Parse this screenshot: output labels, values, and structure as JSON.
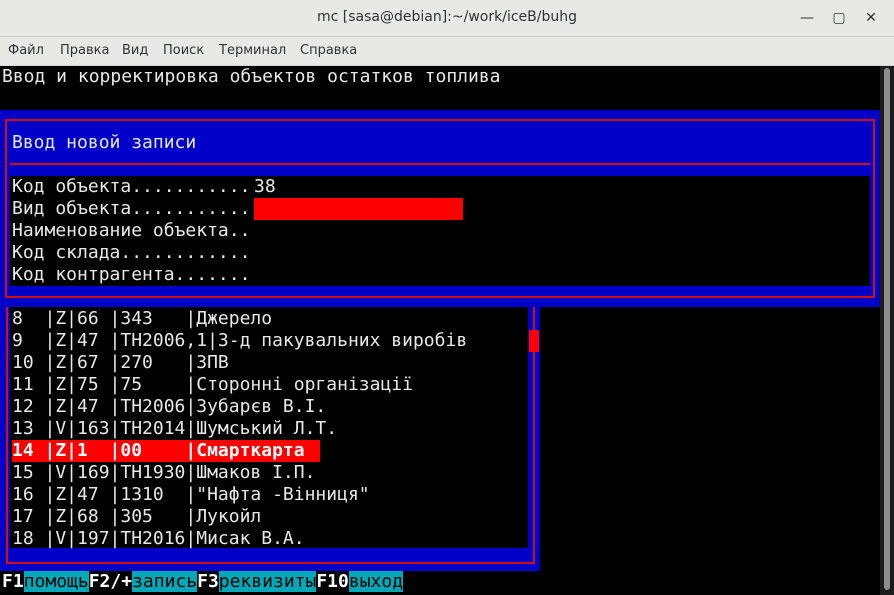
{
  "window": {
    "title": "mc [sasa@debian]:~/work/iceB/buhg"
  },
  "menu": [
    "Файл",
    "Правка",
    "Вид",
    "Поиск",
    "Терминал",
    "Справка"
  ],
  "screen_title": "Ввод и корректировка объектов остатков топлива",
  "dialog": {
    "title": "Ввод новой записи",
    "fields": [
      {
        "label": "Код объекта...........",
        "value": "38"
      },
      {
        "label": "Вид объекта...........",
        "value": ""
      },
      {
        "label": "Наименование объекта..",
        "value": ""
      },
      {
        "label": "Код склада............",
        "value": ""
      },
      {
        "label": "Код контрагента.......",
        "value": ""
      }
    ]
  },
  "list": {
    "rows": [
      "8  |Z|66 |343   |Джерело",
      "9  |Z|47 |TH2006,1|3-д пакувальних виробів",
      "10 |Z|67 |270   |ЗПВ",
      "11 |Z|75 |75    |Сторонні організації",
      "12 |Z|47 |TH2006|Зубарєв В.І.",
      "13 |V|163|TH2014|Шумський Л.Т.",
      "14 |Z|1  |00    |Смарткарта",
      "15 |V|169|TH1930|Шмаков І.П.",
      "16 |Z|47 |1310  |\"Нафта -Вінниця\"",
      "17 |Z|68 |305   |Лукойл",
      "18 |V|197|TH2016|Мисак В.А."
    ],
    "selected_index": 6
  },
  "fkeys": [
    {
      "key": "F1",
      "label": "помощь"
    },
    {
      "key": "F2/+",
      "label": "запись"
    },
    {
      "key": "F3",
      "label": "реквизиты"
    },
    {
      "key": "F10",
      "label": "выход"
    }
  ],
  "colors": {
    "dialog_bg": "#0000c8",
    "border": "#d01010",
    "highlight": "#ff0000",
    "fkey_label_bg": "#00a8b8"
  }
}
